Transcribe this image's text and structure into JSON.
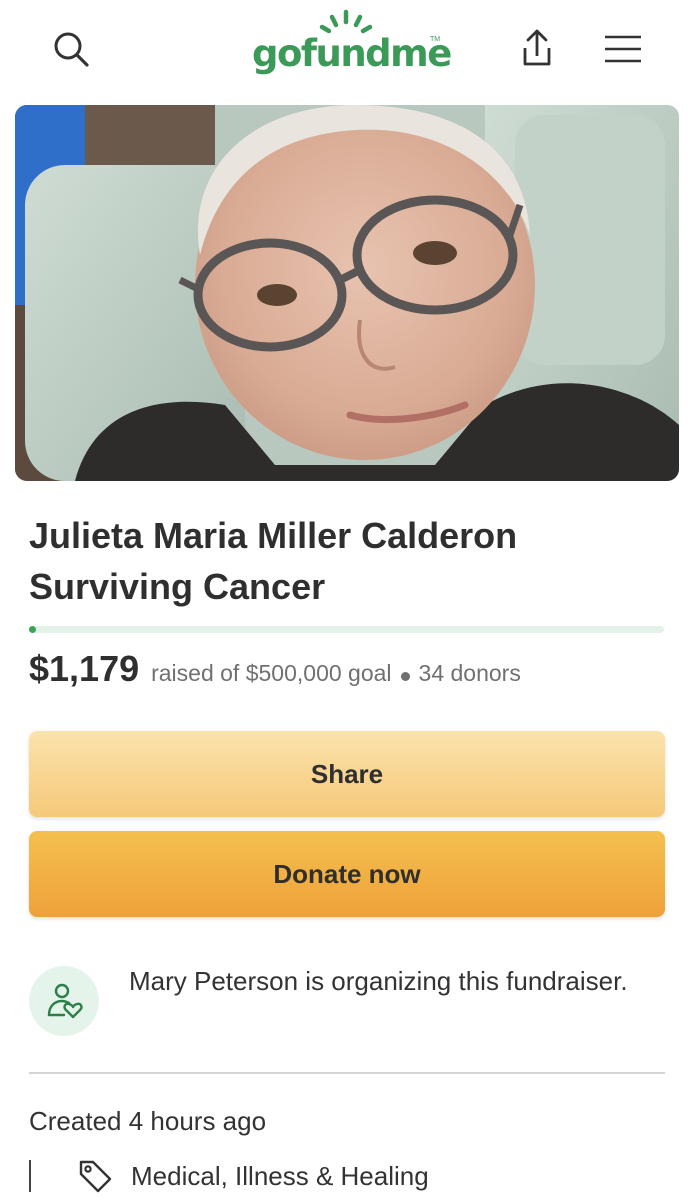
{
  "header": {
    "logo_text": "gofundme",
    "logo_tm": "TM",
    "icons": [
      "search-icon",
      "share-upload-icon",
      "hamburger-menu-icon"
    ]
  },
  "campaign": {
    "title": "Julieta Maria Miller Calderon Surviving Cancer",
    "amount_raised": "$1,179",
    "goal_text": "raised of $500,000 goal",
    "donors_text": "34 donors",
    "progress_fraction": 0.0024
  },
  "actions": {
    "share_label": "Share",
    "donate_label": "Donate now"
  },
  "organizer": {
    "text": "Mary Peterson is organizing this fundraiser.",
    "icon": "organizer-heart-icon"
  },
  "meta": {
    "created": "Created 4 hours ago",
    "category": "Medical, Illness & Healing",
    "category_icon": "tag-icon"
  },
  "colors": {
    "brand_green": "#3b9a57",
    "progress_track": "#e3f1e8",
    "share_button": "#f8d592",
    "donate_button": "#f2b244",
    "text_dark": "#2f2f2f",
    "text_muted": "#707070"
  }
}
